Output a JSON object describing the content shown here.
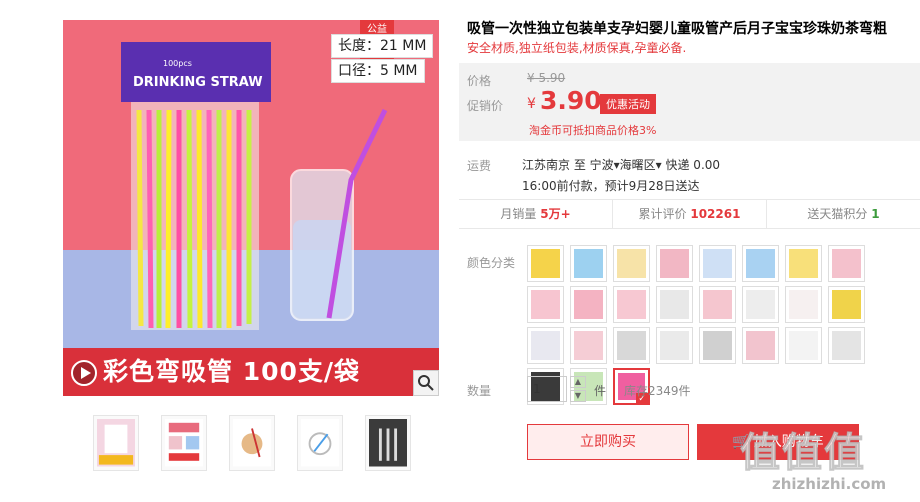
{
  "product": {
    "title": "吸管一次性独立包装单支孕妇婴儿童吸管产后月子宝宝珍珠奶茶弯粗",
    "subtitle": "安全材质,独立纸包装,材质保真,孕童必备."
  },
  "main_image": {
    "badge_line1": "公益",
    "badge_line2": "宝贝",
    "spec_length": "长度：21 MM",
    "spec_diameter": "口径：5 MM",
    "package_brand": "DRINKING STRAW",
    "package_count": "100pcs",
    "banner_text": "彩色弯吸管  100支/袋"
  },
  "price": {
    "price_label": "价格",
    "original": "¥ 5.90",
    "promo_label": "促销价",
    "currency": "¥",
    "current": "3.90",
    "promo_tag": "优惠活动",
    "coin_note": "淘金币可抵扣商品价格3%"
  },
  "shipping": {
    "label": "运费",
    "line1": "江苏南京  至  宁波▾海曙区▾  快递  0.00",
    "line2": "16:00前付款，预计9月28日送达"
  },
  "stats": {
    "monthly_sales_label": "月销量",
    "monthly_sales_value": "5万+",
    "reviews_label": "累计评价",
    "reviews_value": "102261",
    "points_label": "送天猫积分",
    "points_value": "1"
  },
  "options": {
    "color_label": "颜色分类",
    "swatch_count": 27,
    "selected_index": 26
  },
  "purchase": {
    "qty_label": "数量",
    "qty_value": "1",
    "unit": "件",
    "stock": "库存2349件",
    "buy_now": "立即购买",
    "add_to_cart": "加入购物车"
  },
  "watermark": {
    "logo_text": "值什么值得买",
    "domain": "zhizhizhi.com"
  },
  "colors": {
    "accent": "#e4393c",
    "price_bg": "#f2f2f2",
    "banner": "#d9303a",
    "scene_pink": "#f06a7a",
    "scene_blue": "#a8b7e6"
  }
}
